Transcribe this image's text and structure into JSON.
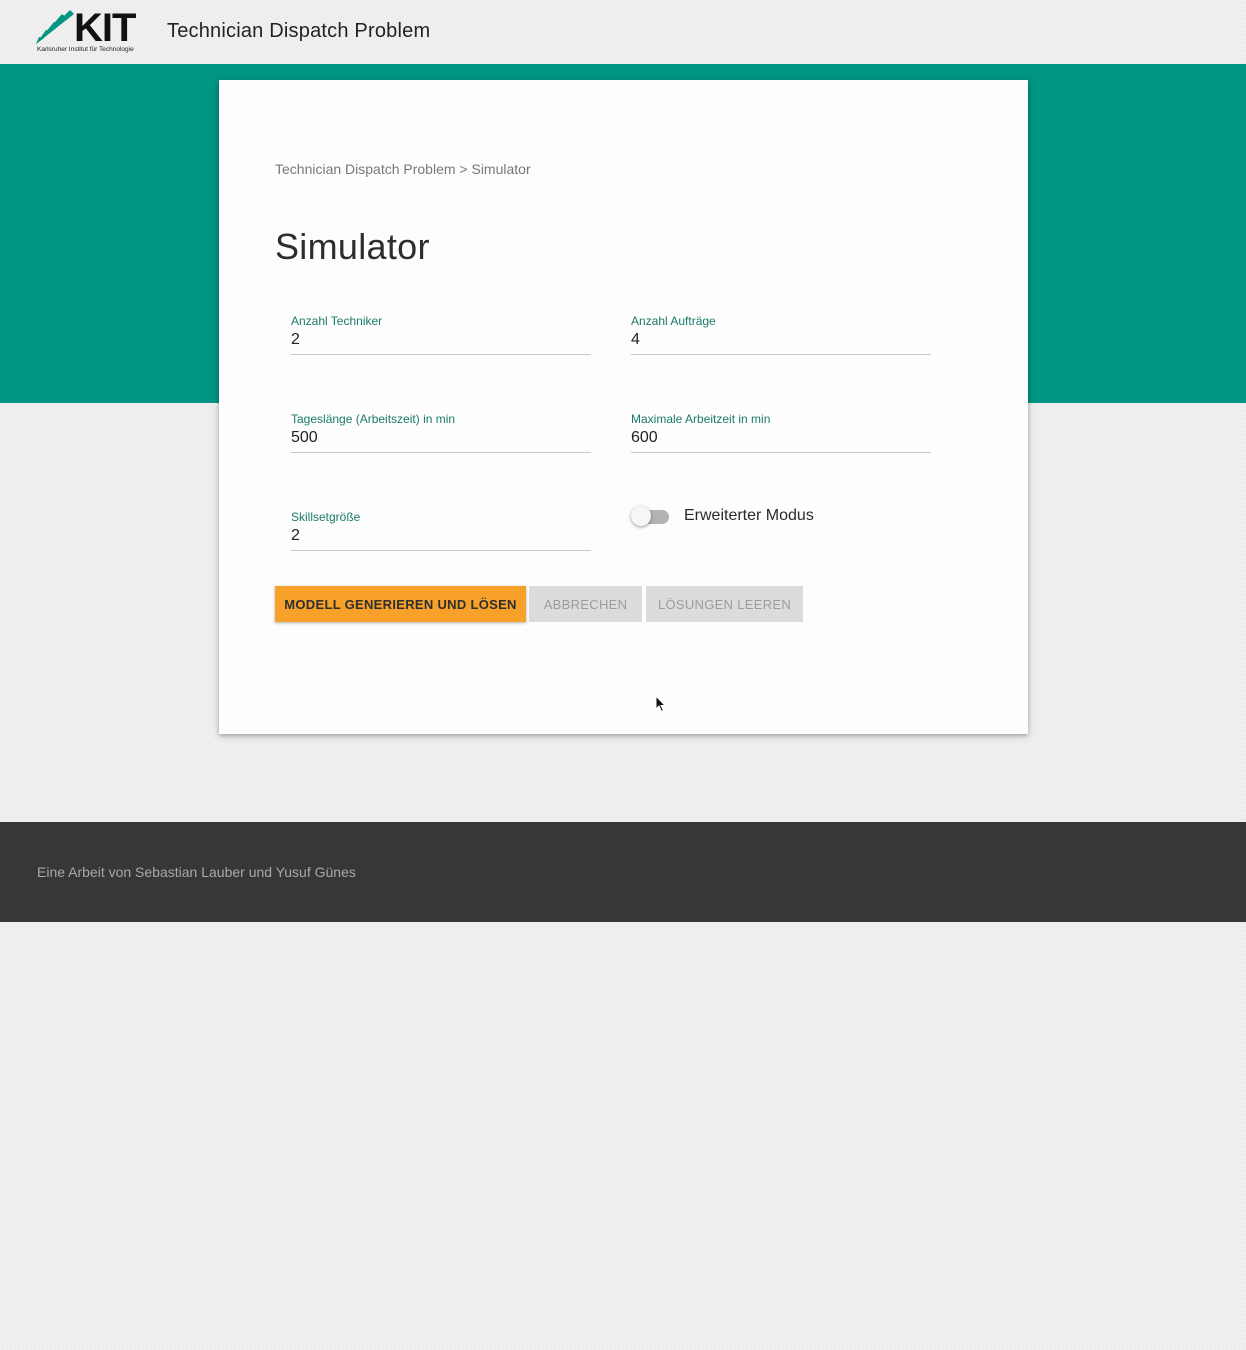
{
  "header": {
    "logo_text": "KIT",
    "logo_subtitle": "Karlsruher Institut für Technologie",
    "app_title": "Technician Dispatch Problem"
  },
  "breadcrumb": "Technician Dispatch Problem > Simulator",
  "page_title": "Simulator",
  "form": {
    "technicians": {
      "label": "Anzahl Techniker",
      "value": "2"
    },
    "orders": {
      "label": "Anzahl Aufträge",
      "value": "4"
    },
    "day_length": {
      "label": "Tageslänge (Arbeitszeit) in min",
      "value": "500"
    },
    "max_work_time": {
      "label": "Maximale Arbeitzeit in min",
      "value": "600"
    },
    "skillset_size": {
      "label": "Skillsetgröße",
      "value": "2"
    },
    "advanced_mode": {
      "label": "Erweiterter Modus",
      "enabled": false
    }
  },
  "buttons": {
    "generate": "MODELL GENERIEREN UND LÖSEN",
    "cancel": "ABBRECHEN",
    "clear": "LÖSUNGEN LEEREN"
  },
  "footer": {
    "text": "Eine Arbeit von Sebastian Lauber und Yusuf Günes"
  },
  "colors": {
    "brand_teal": "#009682",
    "accent_orange": "#f7a02a",
    "footer_bg": "#373737"
  }
}
